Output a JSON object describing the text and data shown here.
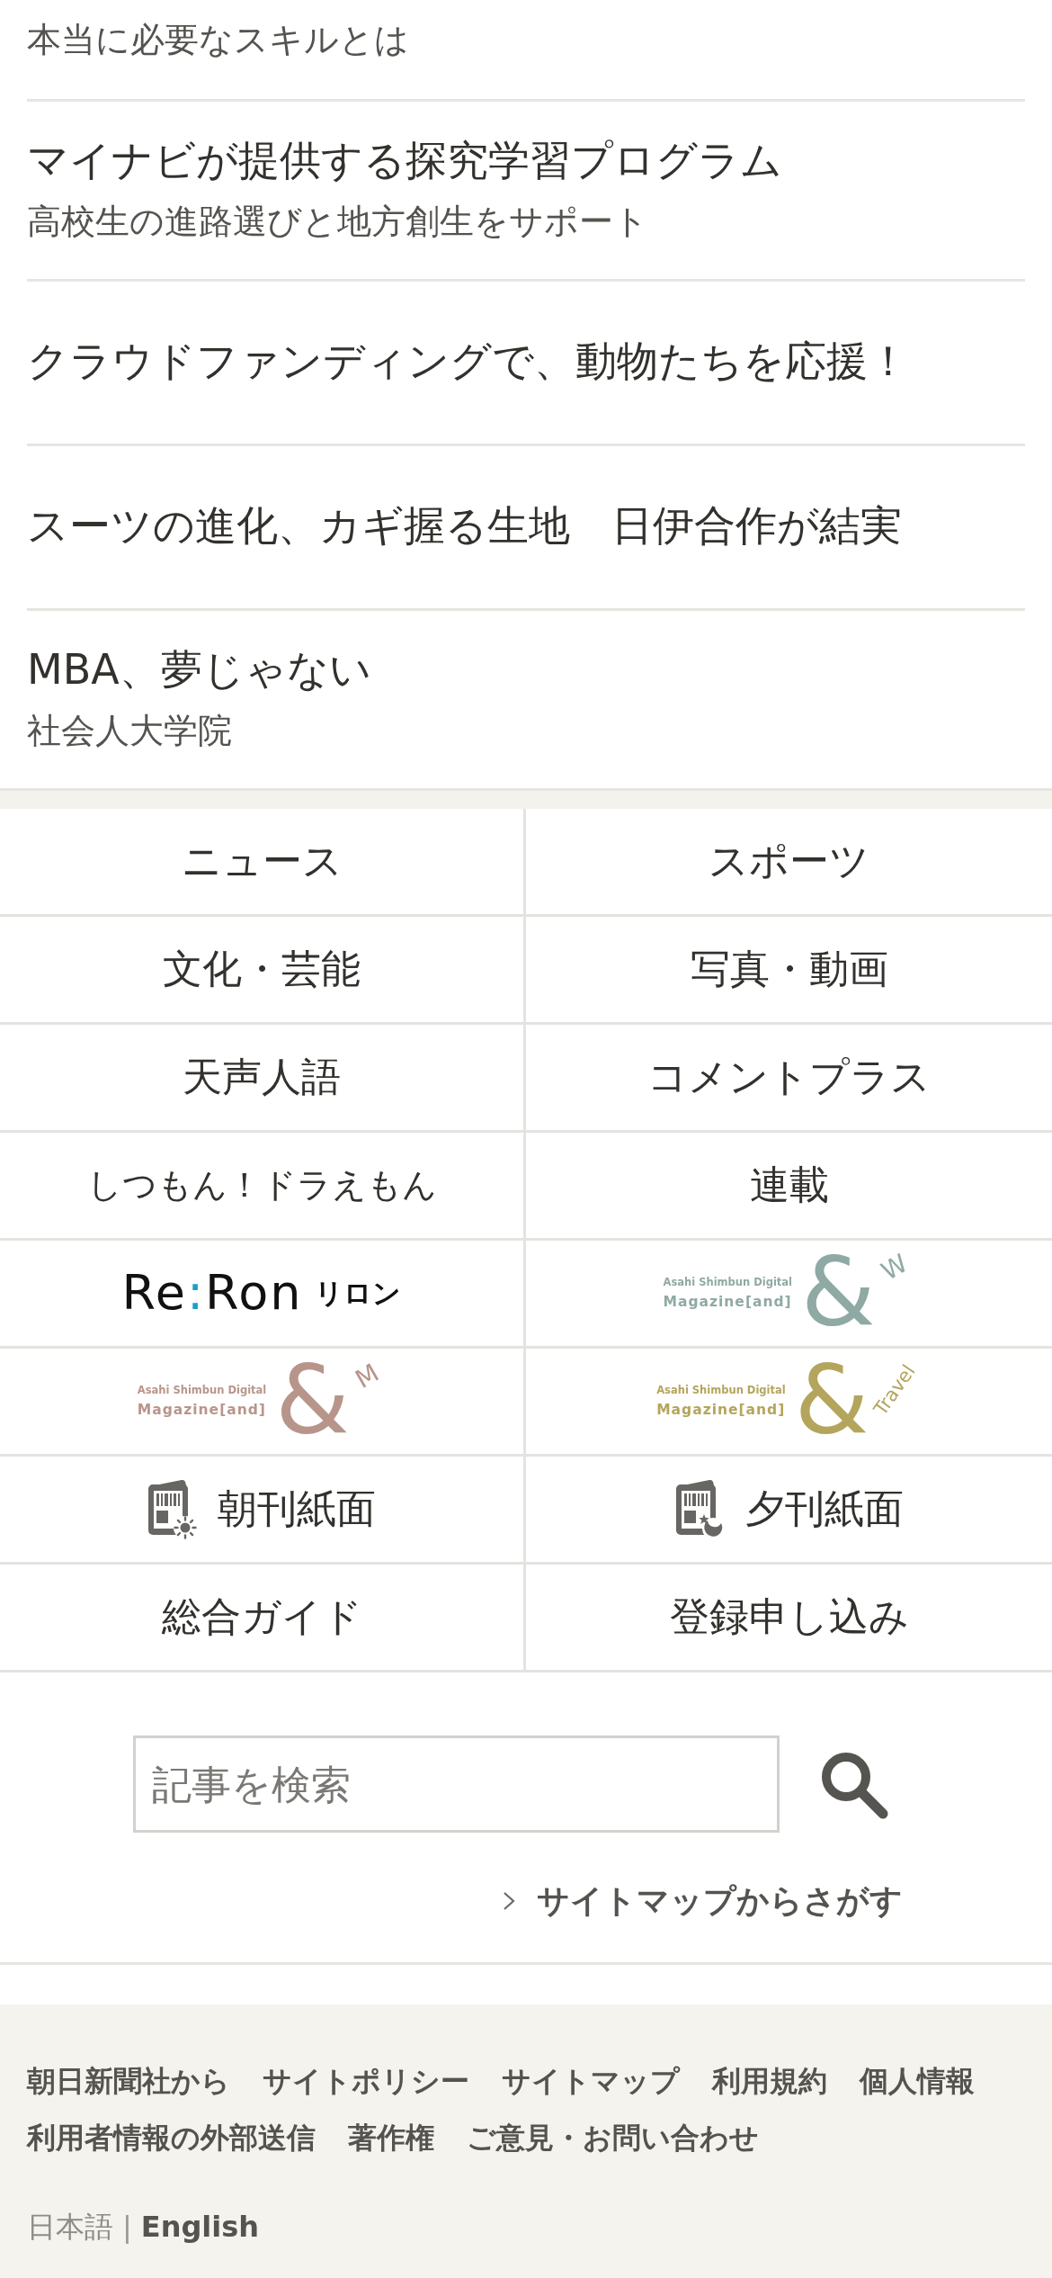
{
  "articles": [
    {
      "subtitle": "本当に必要なスキルとは"
    },
    {
      "title": "マイナビが提供する探究学習プログラム",
      "subtitle": "高校生の進路選びと地方創生をサポート"
    },
    {
      "title": "クラウドファンディングで、動物たちを応援！"
    },
    {
      "title": "スーツの進化、カギ握る生地　日伊合作が結実"
    },
    {
      "title": "MBA、夢じゃない",
      "subtitle": "社会人大学院"
    }
  ],
  "menu": [
    {
      "kind": "text",
      "label": "ニュース"
    },
    {
      "kind": "text",
      "label": "スポーツ"
    },
    {
      "kind": "text",
      "label": "文化・芸能"
    },
    {
      "kind": "text",
      "label": "写真・動画"
    },
    {
      "kind": "text",
      "label": "天声人語"
    },
    {
      "kind": "text",
      "label": "コメントプラス"
    },
    {
      "kind": "text",
      "label": "しつもん！ドラえもん"
    },
    {
      "kind": "text",
      "label": "連載"
    },
    {
      "kind": "reron",
      "label": "Re:Ron",
      "sublabel": "リロン"
    },
    {
      "kind": "magazine",
      "publisher": "Asahi Shimbun Digital",
      "label": "Magazine[and]",
      "mark": "&",
      "suffix": "W",
      "color": "#8fa9a4"
    },
    {
      "kind": "magazine",
      "publisher": "Asahi Shimbun Digital",
      "label": "Magazine[and]",
      "mark": "&",
      "suffix": "M",
      "color": "#b8958a"
    },
    {
      "kind": "magazine",
      "publisher": "Asahi Shimbun Digital",
      "label": "Magazine[and]",
      "mark": "&",
      "suffix": "Travel",
      "color": "#b4a55c"
    },
    {
      "kind": "morning",
      "label": "朝刊紙面"
    },
    {
      "kind": "evening",
      "label": "夕刊紙面"
    },
    {
      "kind": "text",
      "label": "総合ガイド"
    },
    {
      "kind": "text",
      "label": "登録申し込み"
    }
  ],
  "search": {
    "placeholder": "記事を検索"
  },
  "sitemap_link": {
    "label": "サイトマップからさがす"
  },
  "footer": {
    "links": [
      "朝日新聞社から",
      "サイトポリシー",
      "サイトマップ",
      "利用規約",
      "個人情報",
      "利用者情報の外部送信",
      "著作権",
      "ご意見・お問い合わせ"
    ],
    "languages": [
      {
        "label": "日本語",
        "selected": true
      },
      {
        "label": "English",
        "selected": false
      }
    ],
    "language_separator": "|"
  }
}
